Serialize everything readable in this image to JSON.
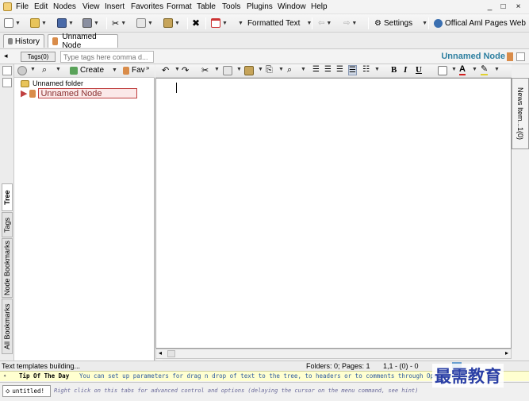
{
  "menu": [
    "File",
    "Edit",
    "Nodes",
    "View",
    "Insert",
    "Favorites",
    "Format",
    "Table",
    "Tools",
    "Plugins",
    "Window",
    "Help"
  ],
  "window_controls": {
    "minimize": "_",
    "restore": "□",
    "close": "×"
  },
  "toolbar": {
    "formatted_text": "Formatted Text",
    "settings": "Settings",
    "web_link": "Offical Aml Pages Web"
  },
  "tabs": {
    "history": "History",
    "node": "Unnamed Node"
  },
  "tags": {
    "button": "Tags(0)",
    "placeholder": "Type tags here comma d...",
    "node_title": "Unnamed Node"
  },
  "left_tabs": [
    "Tree",
    "Tags",
    "Node Bookmarks",
    "All Bookmarks"
  ],
  "tree": {
    "create_label": "Create",
    "fav_label": "Fav",
    "folder": "Unnamed folder",
    "node": "Unnamed Node"
  },
  "right_tab": "News Item...1(0)",
  "status": {
    "message": "Text templates building...",
    "folders_pages": "Folders: 0; Pages: 1",
    "cursor": "1,1 - (0) - 0"
  },
  "tip": {
    "label": "Tip Of The Day",
    "text": "You can set up parameters for drag n drop of text to the tree, to headers or to comments through  Operation..."
  },
  "bottom": {
    "doc_name": "untitled!",
    "hint": "Right click on this tabs for advanced control and options (delaying the cursor on the menu command, see hint)"
  },
  "watermark": "最需教育",
  "colors": {
    "accent": "#2d7fa0",
    "node_highlight": "#c04040",
    "tip_bg": "#ffffd0"
  }
}
